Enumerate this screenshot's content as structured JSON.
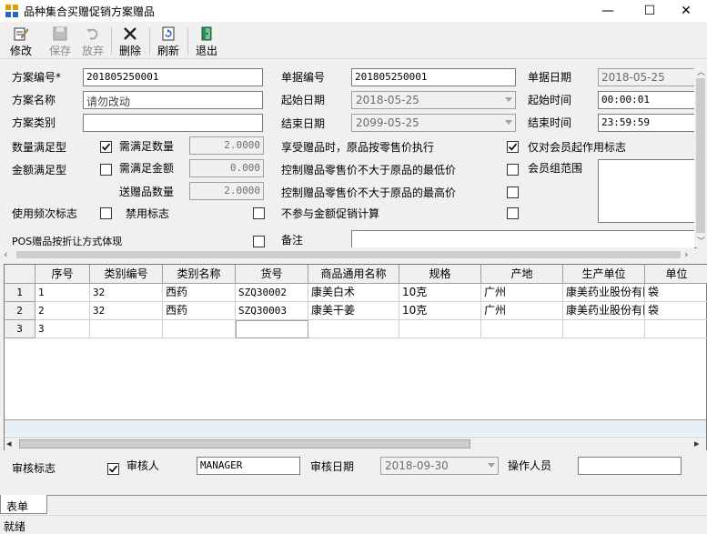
{
  "window": {
    "title": "品种集合买赠促销方案赠品",
    "minimize_glyph": "—",
    "maximize_glyph": "☐",
    "close_glyph": "✕"
  },
  "toolbar": {
    "edit": "修改",
    "save": "保存",
    "discard": "放弃",
    "delete": "删除",
    "refresh": "刷新",
    "exit": "退出"
  },
  "form": {
    "plan_no_label": "方案编号*",
    "plan_no": "201805250001",
    "doc_no_label": "单据编号",
    "doc_no": "201805250001",
    "doc_date_label": "单据日期",
    "doc_date": "2018-05-25",
    "plan_name_label": "方案名称",
    "plan_name": "请勿改动",
    "start_date_label": "起始日期",
    "start_date": "2018-05-25",
    "start_time_label": "起始时间",
    "start_time": "00:00:01",
    "plan_type_label": "方案类别",
    "plan_type": "",
    "end_date_label": "结束日期",
    "end_date": "2099-05-25",
    "end_time_label": "结束时间",
    "end_time": "23:59:59",
    "qty_type_label": "数量满足型",
    "qty_type_checked": true,
    "need_qty_label": "需满足数量",
    "need_qty": "2.0000",
    "gift_retail_label": "享受赠品时，原品按零售价执行",
    "gift_retail_checked": true,
    "member_only_label": "仅对会员起作用标志",
    "member_only_checked": false,
    "amount_type_label": "金额满足型",
    "amount_type_checked": false,
    "need_amount_label": "需满足金额",
    "need_amount": "0.000",
    "ctrl_min_label": "控制赠品零售价不大于原品的最低价",
    "ctrl_min_checked": false,
    "member_group_label": "会员组范围",
    "member_group": "",
    "gift_qty_label": "送赠品数量",
    "gift_qty": "2.0000",
    "ctrl_max_label": "控制赠品零售价不大于原品的最高价",
    "ctrl_max_checked": false,
    "use_freq_label": "使用频次标志",
    "use_freq_checked": false,
    "disable_label": "禁用标志",
    "disable_checked": false,
    "no_amount_calc_label": "不参与金额促销计算",
    "no_amount_calc_checked": false,
    "pos_discount_label": "POS赠品按折让方式体现",
    "pos_discount_checked": false,
    "remark_label": "备注",
    "remark": ""
  },
  "grid": {
    "columns": [
      "序号",
      "类别编号",
      "类别名称",
      "货号",
      "商品通用名称",
      "规格",
      "产地",
      "生产单位",
      "单位"
    ],
    "rows": [
      {
        "header": "1",
        "cells": [
          "1",
          "32",
          "西药",
          "SZQ30002",
          "康美白术",
          "10克",
          "广州",
          "康美药业股份有限",
          "袋"
        ]
      },
      {
        "header": "2",
        "cells": [
          "2",
          "32",
          "西药",
          "SZQ30003",
          "康美干姜",
          "10克",
          "广州",
          "康美药业股份有限",
          "袋"
        ]
      },
      {
        "header": "3",
        "cells": [
          "3",
          "",
          "",
          "",
          "",
          "",
          "",
          "",
          ""
        ]
      }
    ]
  },
  "footer": {
    "audit_flag_label": "审核标志",
    "auditor_checked": true,
    "auditor_label": "审核人",
    "auditor": "MANAGER",
    "audit_date_label": "审核日期",
    "audit_date": "2018-09-30",
    "operator_label": "操作人员",
    "operator": ""
  },
  "tabs": {
    "active": "表单"
  },
  "status": {
    "text": "就绪"
  }
}
